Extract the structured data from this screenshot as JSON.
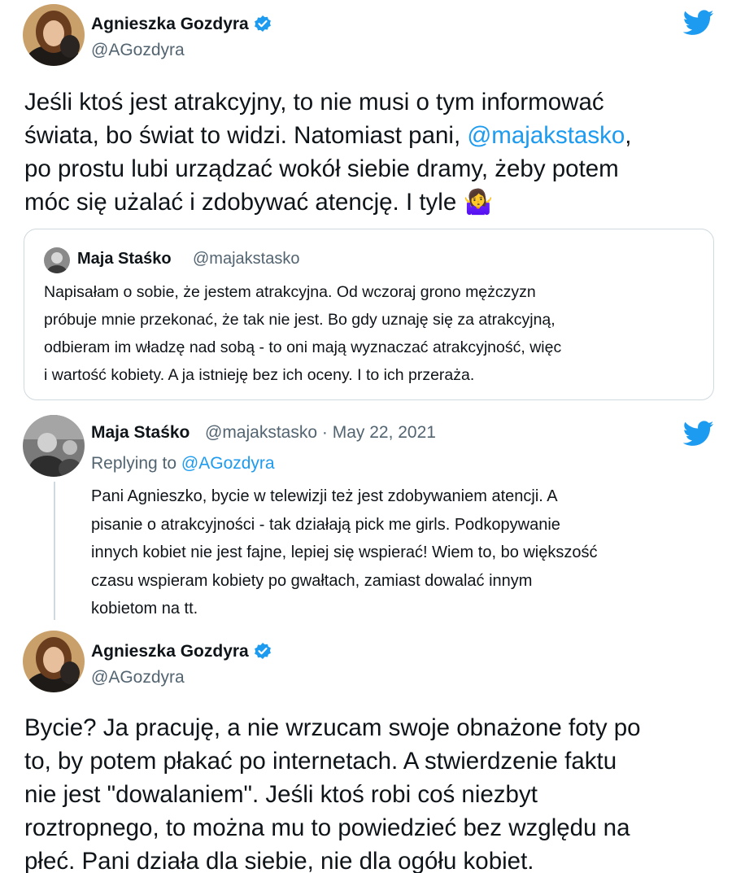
{
  "tweet1": {
    "author_name": "Agnieszka Gozdyra",
    "author_handle": "@AGozdyra",
    "verified": true,
    "text_lines": [
      "Jeśli ktoś jest atrakcyjny, to nie musi o tym informować",
      "świata, bo świat to widzi. Natomiast pani, ",
      "po prostu lubi urządzać wokół siebie dramy, żeby potem",
      "móc się użalać i zdobywać atencję. I tyle"
    ],
    "mention": "@majakstasko",
    "mention_suffix": ",",
    "emoji": "🤷‍♀️",
    "bird_icon": "twitter-bird-icon"
  },
  "quoted_tweet": {
    "author_name": "Maja Staśko",
    "author_handle": "@majakstasko",
    "text_lines": [
      "Napisałam o sobie, że jestem atrakcyjna. Od wczoraj grono mężczyzn",
      "próbuje mnie przekonać, że tak nie jest. Bo gdy uznaję się za atrakcyjną,",
      "odbieram im władzę nad sobą - to oni mają wyznaczać atrakcyjność, więc",
      "i wartość kobiety. A ja istnieję bez ich oceny. I to ich przeraża."
    ]
  },
  "reply_tweet": {
    "author_name": "Maja Staśko",
    "author_handle": "@majakstasko",
    "separator": "·",
    "date": "May 22, 2021",
    "replying_label": "Replying to ",
    "replying_to": "@AGozdyra",
    "text_lines": [
      "Pani Agnieszko, bycie w telewizji też jest zdobywaniem atencji. A",
      "pisanie o atrakcyjności - tak działają pick me girls. Podkopywanie",
      "innych kobiet nie jest fajne, lepiej się wspierać! Wiem to, bo większość",
      "czasu wspieram kobiety po gwałtach, zamiast dowalać innym",
      "kobietom na tt."
    ]
  },
  "tweet2": {
    "author_name": "Agnieszka Gozdyra",
    "author_handle": "@AGozdyra",
    "verified": true,
    "text_lines": [
      "Bycie? Ja pracuję, a nie wrzucam swoje obnażone foty po",
      "to, by potem płakać po internetach. A stwierdzenie faktu",
      "nie jest \"dowalaniem\". Jeśli ktoś robi coś niezbyt",
      "roztropnego, to można mu to powiedzieć bez względu na",
      "płeć. Pani działa dla siebie, nie dla ogółu kobiet."
    ]
  },
  "colors": {
    "accent": "#1d9bf0",
    "text": "#0f1419",
    "secondary": "#536471",
    "border": "#cfd9de"
  }
}
